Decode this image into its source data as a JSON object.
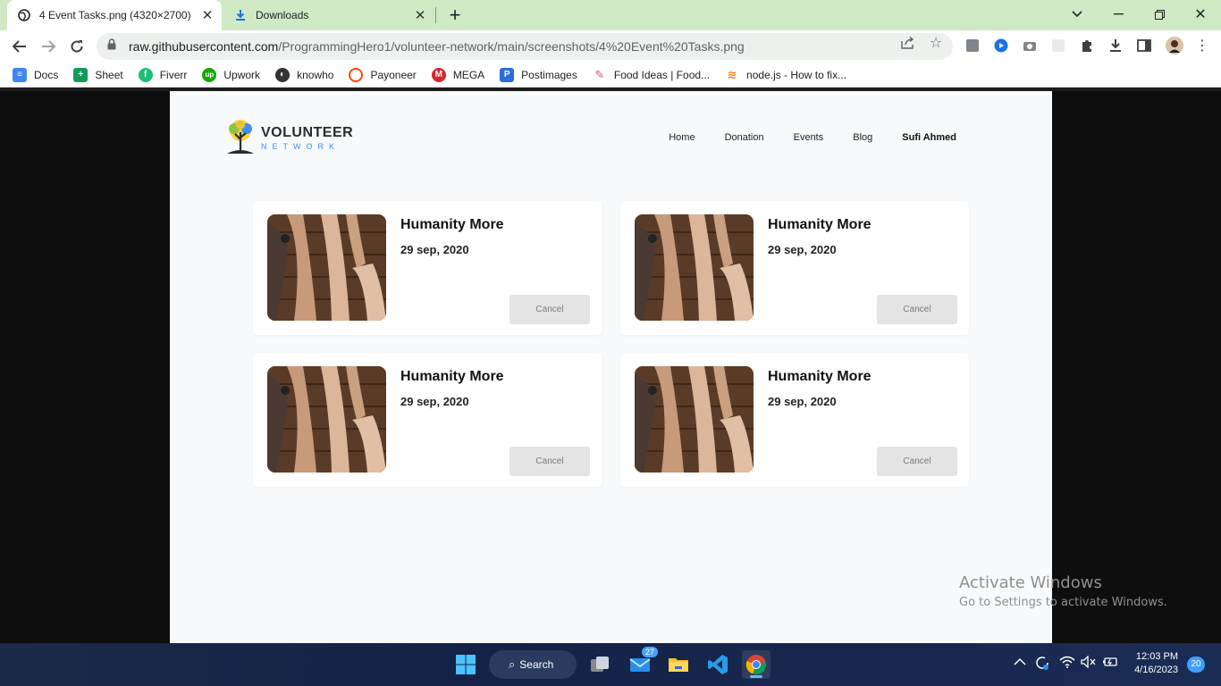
{
  "browser": {
    "tabs": [
      {
        "title": "4 Event Tasks.png (4320×2700)",
        "active": true
      },
      {
        "title": "Downloads",
        "active": false
      }
    ],
    "url_host": "raw.githubusercontent.com",
    "url_path": "/ProgrammingHero1/volunteer-network/main/screenshots/4%20Event%20Tasks.png",
    "bookmarks": [
      {
        "label": "Docs",
        "icon": "docs-icon",
        "color": "#4285f4"
      },
      {
        "label": "Sheet",
        "icon": "sheets-icon",
        "color": "#0f9d58"
      },
      {
        "label": "Fiverr",
        "icon": "fiverr-icon",
        "color": "#1dbf73"
      },
      {
        "label": "Upwork",
        "icon": "upwork-icon",
        "color": "#14a800"
      },
      {
        "label": "knowho",
        "icon": "globe-icon",
        "color": "#333333"
      },
      {
        "label": "Payoneer",
        "icon": "payoneer-icon",
        "color": "#ff4800"
      },
      {
        "label": "MEGA",
        "icon": "mega-icon",
        "color": "#d9272e"
      },
      {
        "label": "Postimages",
        "icon": "postimages-icon",
        "color": "#2d6cdf"
      },
      {
        "label": "Food Ideas | Food...",
        "icon": "pinterest-like-icon",
        "color": "#e44c65"
      },
      {
        "label": "node.js - How to fix...",
        "icon": "stackoverflow-icon",
        "color": "#f48024"
      }
    ]
  },
  "site": {
    "logo_title": "VOLUNTEER",
    "logo_sub": "NETWORK",
    "nav": [
      "Home",
      "Donation",
      "Events",
      "Blog"
    ],
    "user": "Sufi Ahmed",
    "events": [
      {
        "title": "Humanity More",
        "date": "29 sep, 2020",
        "action": "Cancel"
      },
      {
        "title": "Humanity More",
        "date": "29 sep, 2020",
        "action": "Cancel"
      },
      {
        "title": "Humanity More",
        "date": "29 sep, 2020",
        "action": "Cancel"
      },
      {
        "title": "Humanity More",
        "date": "29 sep, 2020",
        "action": "Cancel"
      }
    ]
  },
  "watermark": {
    "line1": "Activate Windows",
    "line2": "Go to Settings to activate Windows."
  },
  "taskbar": {
    "search_label": "Search",
    "mail_badge": "27",
    "time": "12:03 PM",
    "date": "4/16/2023",
    "notifications": "20"
  }
}
